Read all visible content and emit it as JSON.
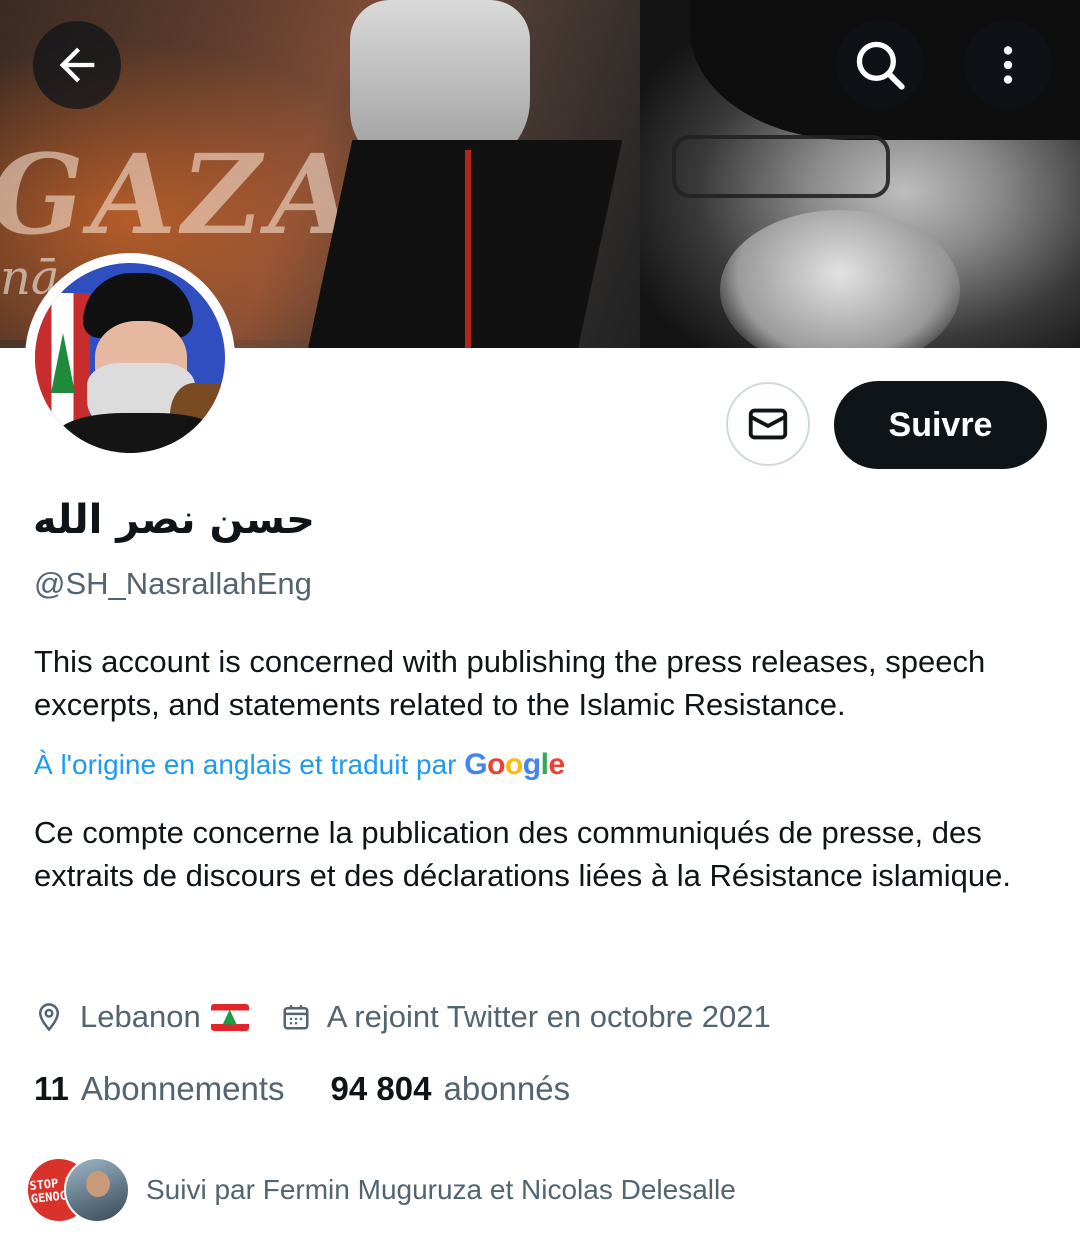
{
  "header": {
    "back_icon": "arrow-left-icon",
    "search_icon": "search-icon",
    "more_icon": "more-vertical-icon"
  },
  "banner": {
    "text_main": "GAZA",
    "text_sub": "nā nis"
  },
  "profile": {
    "display_name": "حسن نصر الله",
    "handle": "@SH_NasrallahEng",
    "bio": "This account is concerned with publishing the press releases, speech excerpts, and statements related to the Islamic Resistance.",
    "translation_note": "À l'origine en anglais et traduit par",
    "translation_provider": "Google",
    "bio_translated": "Ce compte concerne la publication des communiqués de presse, des extraits de discours et des déclarations liées à la Résistance islamique.",
    "location": "Lebanon",
    "location_flag": "lebanon-flag",
    "joined": "A rejoint Twitter en octobre 2021"
  },
  "actions": {
    "message_icon": "mail-icon",
    "follow_label": "Suivre"
  },
  "stats": {
    "following_count": "11",
    "following_label": "Abonnements",
    "followers_count": "94 804",
    "followers_label": "abonnés"
  },
  "followed_by": {
    "avatar1_text": "STOP THE GENOCIDE",
    "text": "Suivi par Fermin Muguruza et Nicolas Delesalle"
  },
  "colors": {
    "primary_text": "#0f1419",
    "secondary_text": "#536471",
    "link": "#1d9bf0",
    "button_dark": "#0f1419"
  }
}
